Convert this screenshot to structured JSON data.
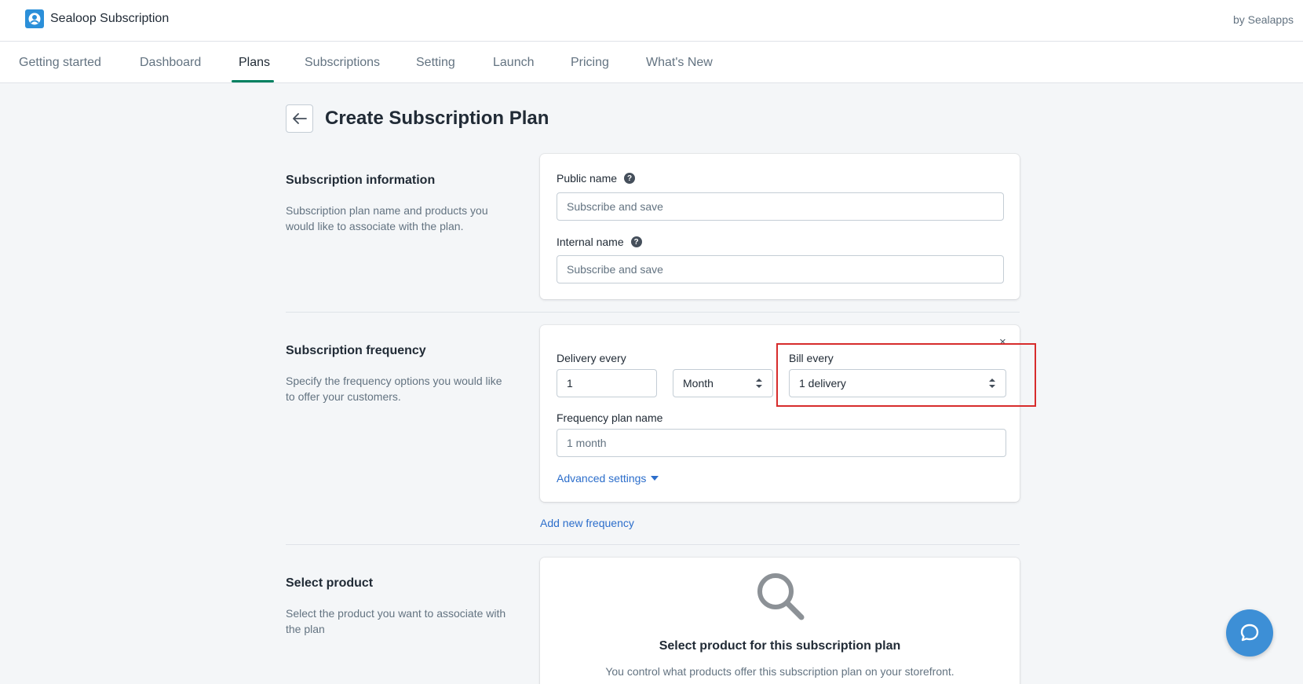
{
  "app": {
    "title": "Sealoop Subscription",
    "by_line": "by Sealapps"
  },
  "tabs": [
    {
      "label": "Getting started"
    },
    {
      "label": "Dashboard"
    },
    {
      "label": "Plans",
      "active": true
    },
    {
      "label": "Subscriptions"
    },
    {
      "label": "Setting"
    },
    {
      "label": "Launch"
    },
    {
      "label": "Pricing"
    },
    {
      "label": "What's New"
    }
  ],
  "page": {
    "title": "Create Subscription Plan"
  },
  "subscription_information": {
    "title": "Subscription information",
    "description": "Subscription plan name and products you would like to associate with the plan.",
    "public_name": {
      "label": "Public name",
      "placeholder": "Subscribe and save"
    },
    "internal_name": {
      "label": "Internal name",
      "placeholder": "Subscribe and save"
    }
  },
  "subscription_frequency": {
    "title": "Subscription frequency",
    "description": "Specify the frequency options you would like to offer your customers.",
    "delivery_every": {
      "label": "Delivery every",
      "value": "1"
    },
    "interval_unit": {
      "value": "Month"
    },
    "bill_every": {
      "label": "Bill every",
      "value": "1 delivery"
    },
    "frequency_plan_name": {
      "label": "Frequency plan name",
      "placeholder": "1 month"
    },
    "advanced_settings": "Advanced settings",
    "remove_symbol": "×",
    "add_new_frequency": "Add new frequency"
  },
  "select_product": {
    "title": "Select product",
    "description": "Select the product you want to associate with the plan",
    "empty_title": "Select product for this subscription plan",
    "empty_desc": "You control what products offer this subscription plan on your storefront."
  },
  "colors": {
    "accent": "#008060",
    "link": "#2c6ecb",
    "highlight": "#d72c2c",
    "chat": "#3d8fd6"
  }
}
